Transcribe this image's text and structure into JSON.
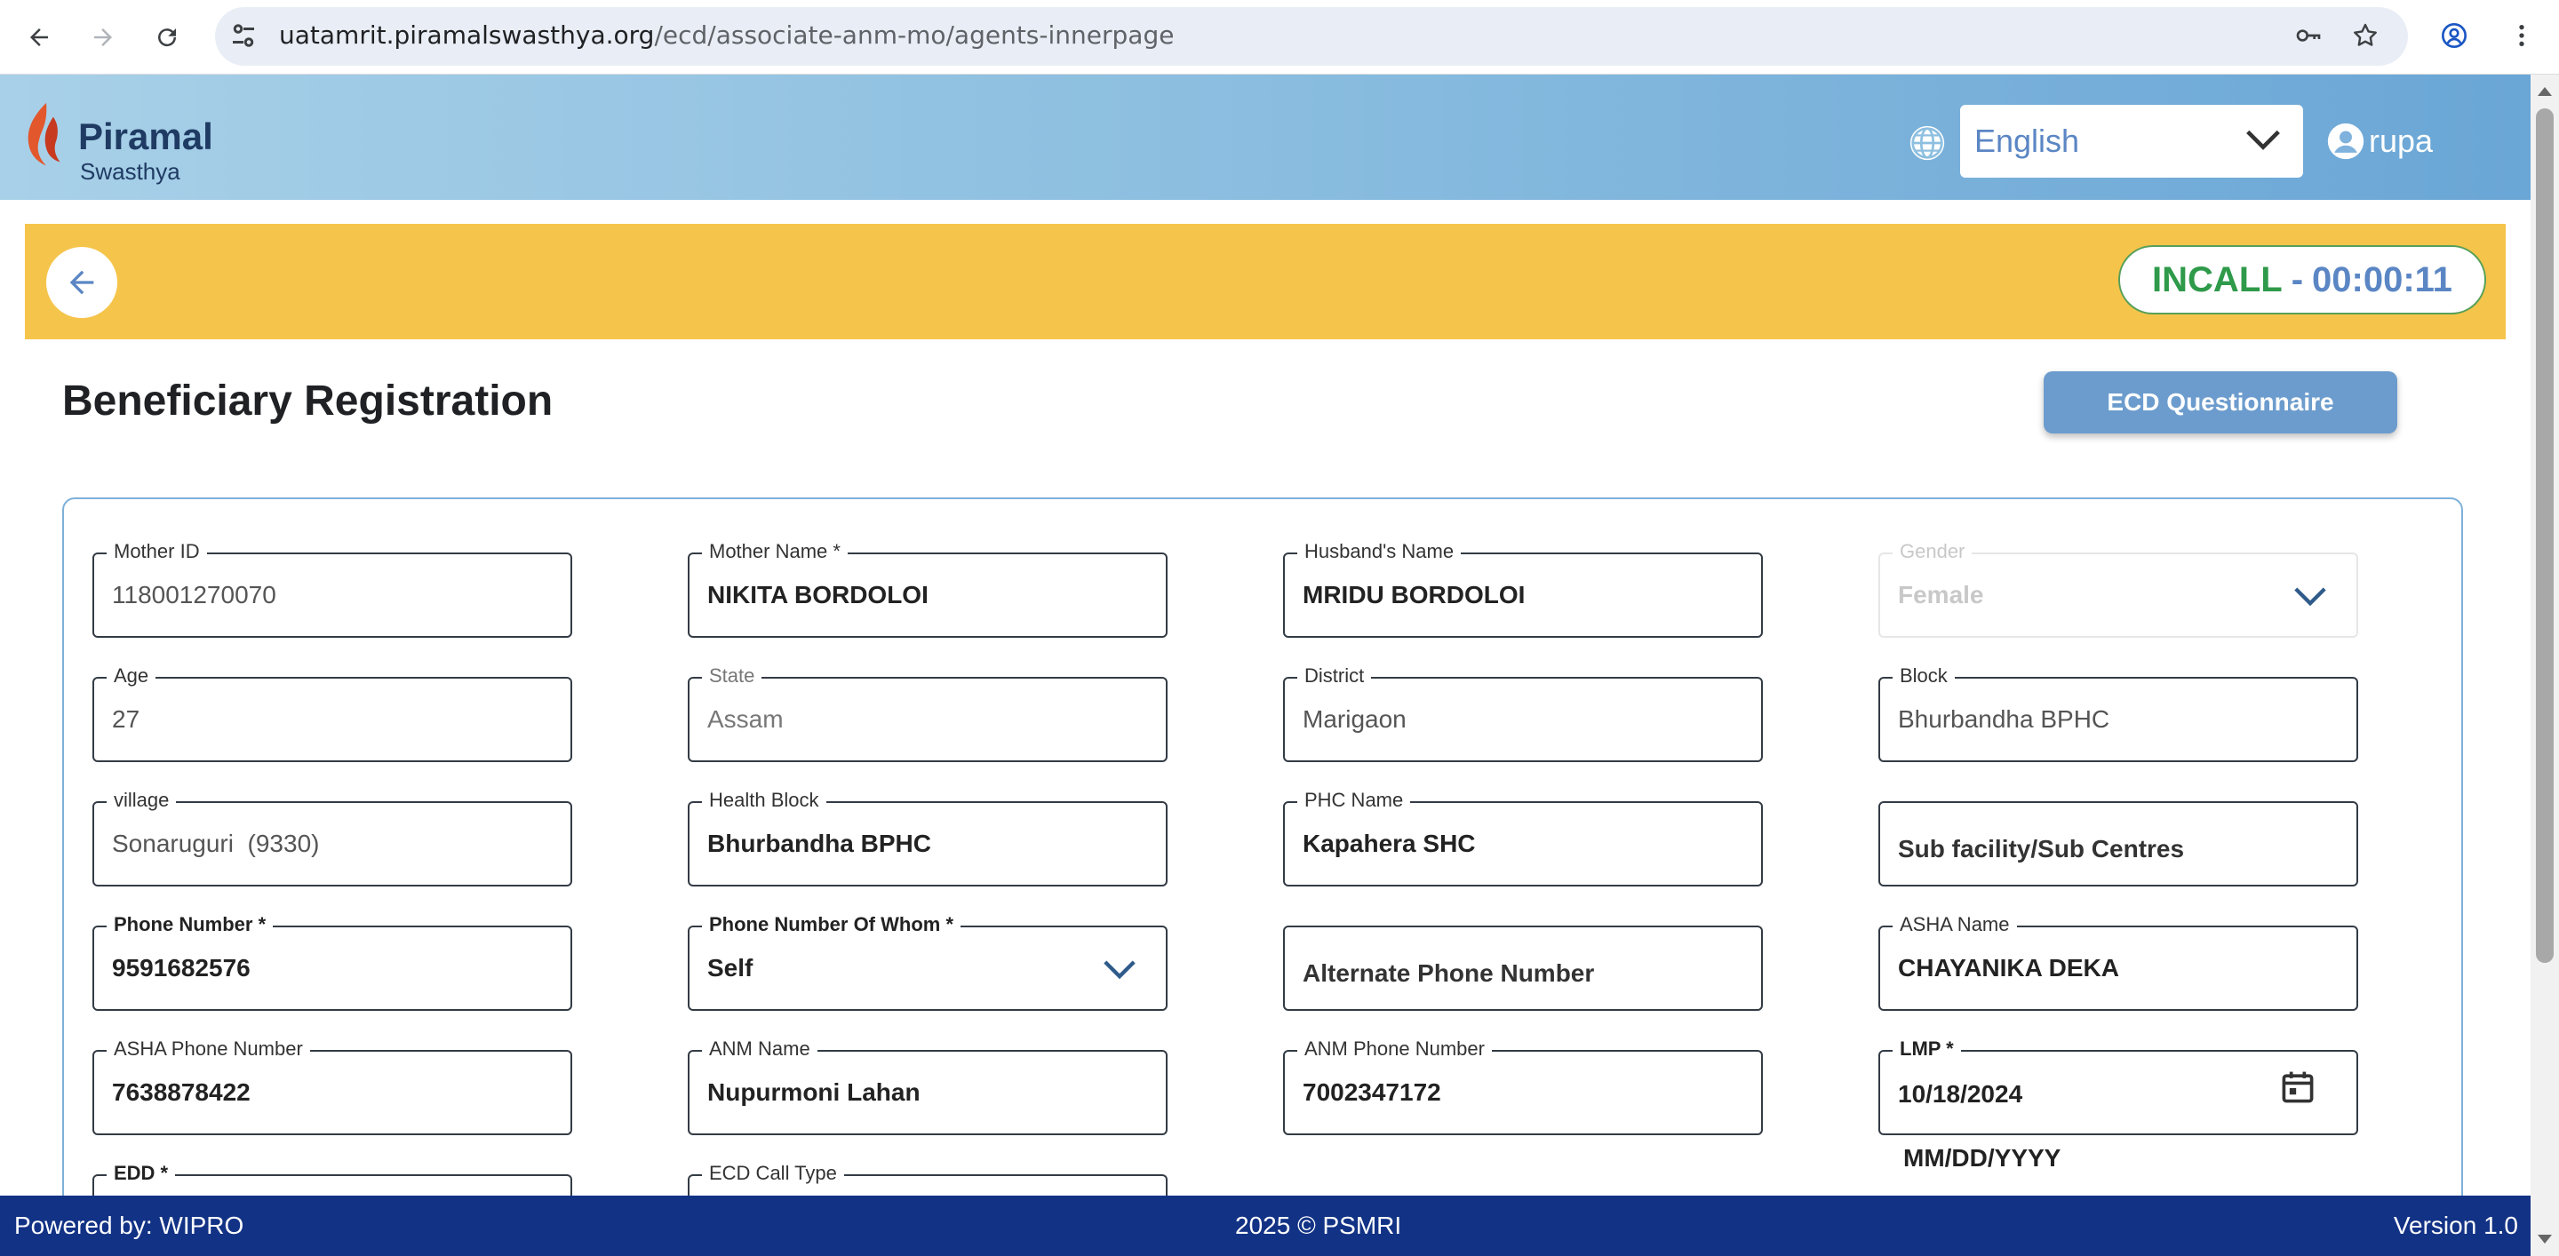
{
  "browser": {
    "url_domain": "uatamrit.piramalswasthya.org",
    "url_path": "/ecd/associate-anm-mo/agents-innerpage",
    "icons": [
      "back-arrow-icon",
      "forward-arrow-icon",
      "reload-icon",
      "site-settings-icon",
      "password-key-icon",
      "bookmark-star-icon",
      "profile-icon",
      "more-menu-icon"
    ]
  },
  "header": {
    "logo_word": "Piramal",
    "logo_sub": "Swasthya",
    "language": "English",
    "username": "rupa"
  },
  "call_bar": {
    "status": "INCALL",
    "separator": "-",
    "timer": "00:00:11"
  },
  "page": {
    "title": "Beneficiary Registration",
    "ecd_button": "ECD Questionnaire"
  },
  "form": {
    "mother_id": {
      "label": "Mother ID",
      "value": "118001270070"
    },
    "mother_name": {
      "label": "Mother Name *",
      "value": "NIKITA BORDOLOI"
    },
    "husband_name": {
      "label": "Husband's Name",
      "value": "MRIDU BORDOLOI"
    },
    "gender": {
      "label": "Gender",
      "value": "Female"
    },
    "age": {
      "label": "Age",
      "value": "27"
    },
    "state": {
      "label": "State",
      "value": "Assam"
    },
    "district": {
      "label": "District",
      "value": "Marigaon"
    },
    "block": {
      "label": "Block",
      "value": "Bhurbandha BPHC"
    },
    "village": {
      "label": "village",
      "value": "Sonaruguri  (9330)"
    },
    "health_block": {
      "label": "Health Block",
      "value": "Bhurbandha BPHC"
    },
    "phc_name": {
      "label": "PHC Name",
      "value": "Kapahera SHC"
    },
    "sub_facility": {
      "placeholder": "Sub facility/Sub Centres"
    },
    "phone_number": {
      "label": "Phone Number *",
      "value": "9591682576"
    },
    "phone_of_whom": {
      "label": "Phone Number Of Whom *",
      "value": "Self"
    },
    "alternate_phone": {
      "placeholder": "Alternate Phone Number"
    },
    "asha_name": {
      "label": "ASHA Name",
      "value": "CHAYANIKA DEKA"
    },
    "asha_phone": {
      "label": "ASHA Phone Number",
      "value": "7638878422"
    },
    "anm_name": {
      "label": "ANM Name",
      "value": "Nupurmoni Lahan"
    },
    "anm_phone": {
      "label": "ANM Phone Number",
      "value": "7002347172"
    },
    "lmp": {
      "label": "LMP *",
      "value": "10/18/2024",
      "hint": "MM/DD/YYYY"
    },
    "edd": {
      "label": "EDD *"
    },
    "ecd_call_type": {
      "label": "ECD Call Type"
    }
  },
  "footer": {
    "powered_by": "Powered by: WIPRO",
    "copyright": "2025 © PSMRI",
    "version": "Version 1.0"
  },
  "colors": {
    "header_gradient_start": "#a8d0e8",
    "header_gradient_end": "#6aa6d6",
    "call_bar": "#f5c44a",
    "incall_green": "#2e9a4a",
    "timer_blue": "#5b86c4",
    "button_blue": "#6c9ccd",
    "footer_navy": "#123285"
  }
}
